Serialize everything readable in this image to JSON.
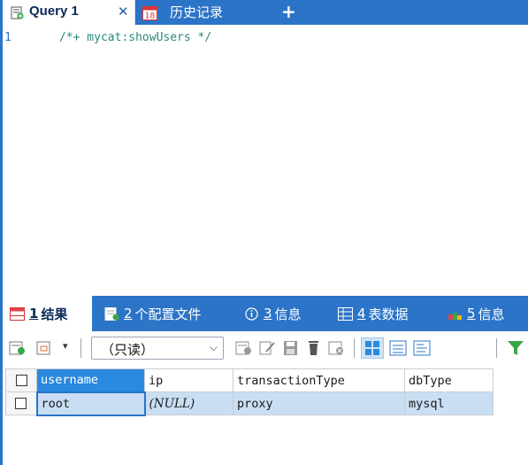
{
  "query_tabs": {
    "active_label": "Query 1",
    "close_glyph": "✕",
    "history_label": "历史记录",
    "history_badge": "18",
    "add_glyph": "+"
  },
  "editor": {
    "line_number": "1",
    "line_text": "/*+ mycat:showUsers */"
  },
  "result_tabs": [
    {
      "num": "1",
      "label": "结果"
    },
    {
      "num": "2",
      "label": "个配置文件"
    },
    {
      "num": "3",
      "label": "信息"
    },
    {
      "num": "4",
      "label": "表数据"
    },
    {
      "num": "5",
      "label": "信息"
    }
  ],
  "toolbar": {
    "mode_select": "（只读）",
    "caret": "⌵"
  },
  "grid": {
    "columns": [
      "username",
      "ip",
      "transactionType",
      "dbType"
    ],
    "rows": [
      [
        "root",
        "(NULL)",
        "proxy",
        "mysql"
      ]
    ]
  },
  "colors": {
    "accent": "#2b74c7",
    "selected_header": "#2b8ae0",
    "row_highlight": "#c9def3"
  }
}
